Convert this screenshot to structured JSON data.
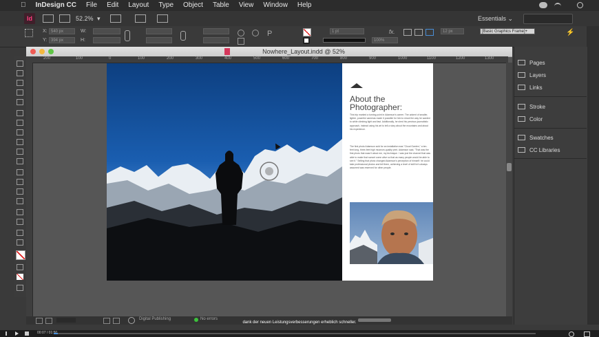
{
  "menubar": {
    "apple": "",
    "items": [
      "InDesign CC",
      "File",
      "Edit",
      "Layout",
      "Type",
      "Object",
      "Table",
      "View",
      "Window",
      "Help"
    ]
  },
  "appbar": {
    "app_badge": "Id",
    "zoom": "52.2%",
    "workspace": "Essentials",
    "workspace_arrow": "⌄"
  },
  "control_panel": {
    "x_label": "X:",
    "x_value": "540 px",
    "y_label": "Y:",
    "y_value": "394 px",
    "w_label": "W:",
    "h_label": "H:",
    "stroke_weight": "1 pt",
    "opacity": "100%",
    "size_value": "12 px",
    "frame_style": "[Basic Graphics Frame]+"
  },
  "document": {
    "title": "Nowhere_Layout.indd @ 52%",
    "ruler_ticks": [
      "200",
      "100",
      "0",
      "100",
      "200",
      "300",
      "400",
      "500",
      "600",
      "700",
      "800",
      "900",
      "1000",
      "1100",
      "1200",
      "1300"
    ]
  },
  "page": {
    "about_title": "About the Photographer:",
    "paragraph1": "This trip marked a turning point in Adamson's career. The advent of smaller, lighter, powerful cameras made it possible for him to shoot the way he wanted to while climbing light and fast. Additionally, he shed his previous journalistic approach, instead using his art to tell a story about the mountains and about his experience.",
    "paragraph2": "The first photo Adamson sold for an installation was \"Cloud Garden,\" a ten-feet long, three-feet high museum-quality print. Adamson said, \"That was the first photo that wasn't about me, my technique. I was just the channel that was able to make that sunset come alive so that as many people would be able to see it.\" Selling that photo changed Adamson's perception of himself: he could take professional photos and tell them, achieving a level of skill he's always assumed was reserved for other people."
  },
  "panels": [
    "Pages",
    "Layers",
    "Links",
    "Stroke",
    "Color",
    "Swatches",
    "CC Libraries"
  ],
  "statusbar": {
    "preflight_profile": "Digital Publishing",
    "errors": "No errors"
  },
  "subtitle": "dank der neuen Leistungsverbesserungen erheblich schneller.",
  "player": {
    "time": "00:07 / 01:50"
  },
  "colors": {
    "accent_pink": "#ff3f7f",
    "sky_blue": "#1a5eb0"
  }
}
